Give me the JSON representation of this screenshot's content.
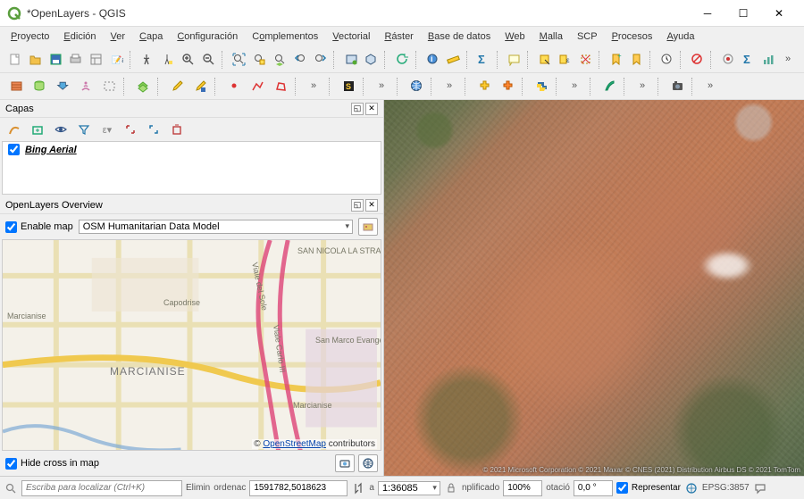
{
  "window": {
    "title": "*OpenLayers - QGIS"
  },
  "menu": {
    "items": [
      "Proyecto",
      "Edición",
      "Ver",
      "Capa",
      "Configuración",
      "Complementos",
      "Vectorial",
      "Ráster",
      "Base de datos",
      "Web",
      "Malla",
      "SCP",
      "Procesos",
      "Ayuda"
    ],
    "underlines": [
      0,
      0,
      0,
      0,
      0,
      1,
      0,
      0,
      0,
      0,
      0,
      null,
      0,
      0
    ]
  },
  "panels": {
    "layers": {
      "title": "Capas"
    },
    "overview": {
      "title": "OpenLayers Overview"
    }
  },
  "layers": {
    "items": [
      {
        "name": "Bing Aerial",
        "checked": true
      }
    ]
  },
  "overview": {
    "enable_label": "Enable map",
    "enable_checked": true,
    "basemap_selected": "OSM Humanitarian Data Model",
    "hide_cross_label": "Hide cross in map",
    "hide_cross_checked": true,
    "attribution_link": "OpenStreetMap",
    "attribution_tail": " contributors",
    "places": {
      "marcianise": "MARCIANISE",
      "capodrise": "Capodrise",
      "san_nicola": "SAN NICOLA LA STRADA",
      "marcianise_small1": "Marcianise",
      "marcianise_small2": "Marcianise",
      "san_marco": "San Marco Evangelista",
      "viale_sole": "Viale del Sole",
      "viale_carlo": "Viale Carlo III"
    }
  },
  "status": {
    "search_placeholder": "Escriba para localizar (Ctrl+K)",
    "elimin": "Elimin",
    "coord_label": "ordenac",
    "coord_value": "1591782,5018623",
    "scale_label": "a",
    "scale_value": "1:36085",
    "simplif_label": "nplificado",
    "simplif_value": "100%",
    "rot_label": "otació",
    "rot_value": "0,0 °",
    "render_label": "Representar",
    "render_checked": true,
    "epsg": "EPSG:3857"
  },
  "toolbar_icons": {
    "row1": [
      "new-project",
      "open-project",
      "save-project",
      "print-layout",
      "layout-manager",
      "style-manager",
      "sep",
      "pan",
      "pan-to-selection",
      "zoom-in",
      "zoom-out",
      "sep",
      "zoom-full",
      "zoom-selection",
      "zoom-layer",
      "zoom-last",
      "zoom-next",
      "sep",
      "new-map-view",
      "new-3d-view",
      "sep",
      "refresh",
      "sep",
      "identify",
      "measure",
      "sep",
      "statistics",
      "sep",
      "show-tips",
      "sep",
      "select-features",
      "select-by-value",
      "deselect",
      "sep",
      "new-bookmark",
      "show-bookmarks",
      "sep",
      "temporal",
      "sep",
      "no-action",
      "sep",
      "decoration",
      "sigma",
      "chart",
      "more"
    ],
    "row2": [
      "data-source-manager",
      "new-geopackage",
      "new-shapefile",
      "new-spatialite",
      "new-virtual",
      "sep",
      "vector-new",
      "sep",
      "toggle-editing",
      "save-edits",
      "sep",
      "digitize-point",
      "digitize-line",
      "digitize-polygon",
      "sep",
      "more",
      "sep",
      "scp-dock",
      "sep",
      "more",
      "sep",
      "web",
      "sep",
      "more",
      "sep",
      "plugin-yellow",
      "plugin-orange",
      "sep",
      "python",
      "sep",
      "more",
      "sep",
      "feather",
      "sep",
      "more",
      "sep",
      "camera",
      "sep",
      "more"
    ]
  }
}
